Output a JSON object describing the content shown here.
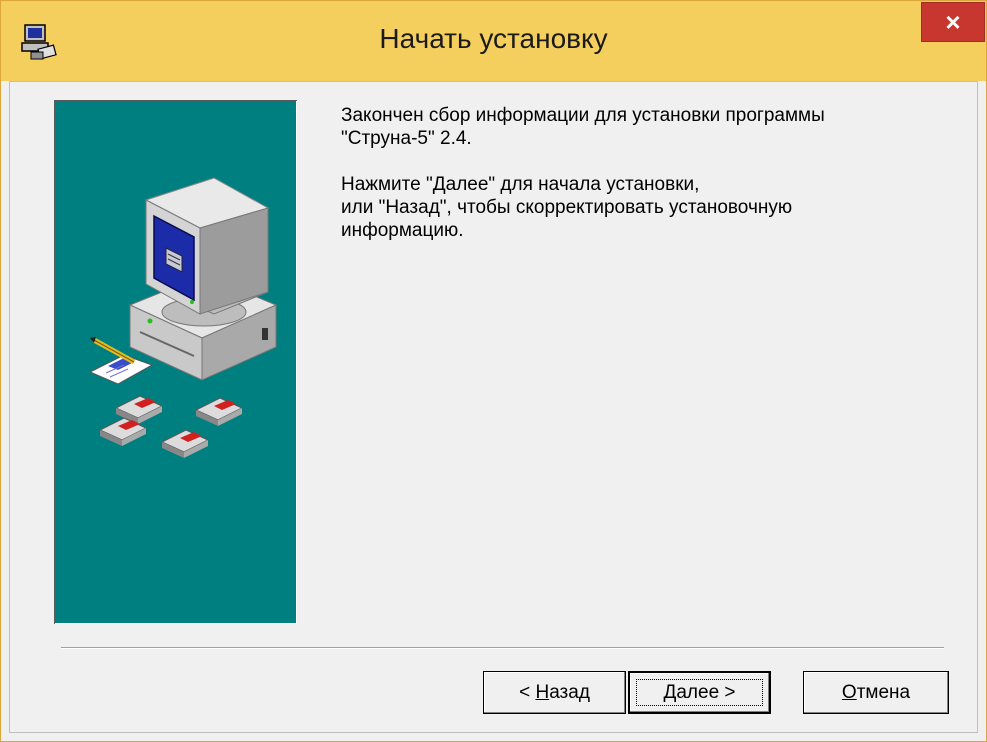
{
  "window": {
    "title": "Начать установку",
    "close_label": "×"
  },
  "message": {
    "line1": "Закончен сбор информации для установки программы",
    "line2": "\"Струна-5\" 2.4.",
    "line3": "Нажмите \"Далее\" для начала установки,",
    "line4": "или \"Назад\", чтобы скорректировать установочную",
    "line5": "информацию."
  },
  "buttons": {
    "back": {
      "prefix": "< ",
      "mnemonic": "Н",
      "rest": "азад"
    },
    "next": {
      "mnemonic": "Д",
      "rest": "алее >"
    },
    "cancel": {
      "mnemonic": "О",
      "rest": "тмена"
    }
  },
  "colors": {
    "titlebar": "#f5cf5e",
    "close": "#c7372f",
    "art_panel": "#007f80"
  },
  "icons": {
    "app": "installer-computer-icon",
    "close": "close-icon",
    "illustration": "computer-with-floppies-illustration"
  }
}
